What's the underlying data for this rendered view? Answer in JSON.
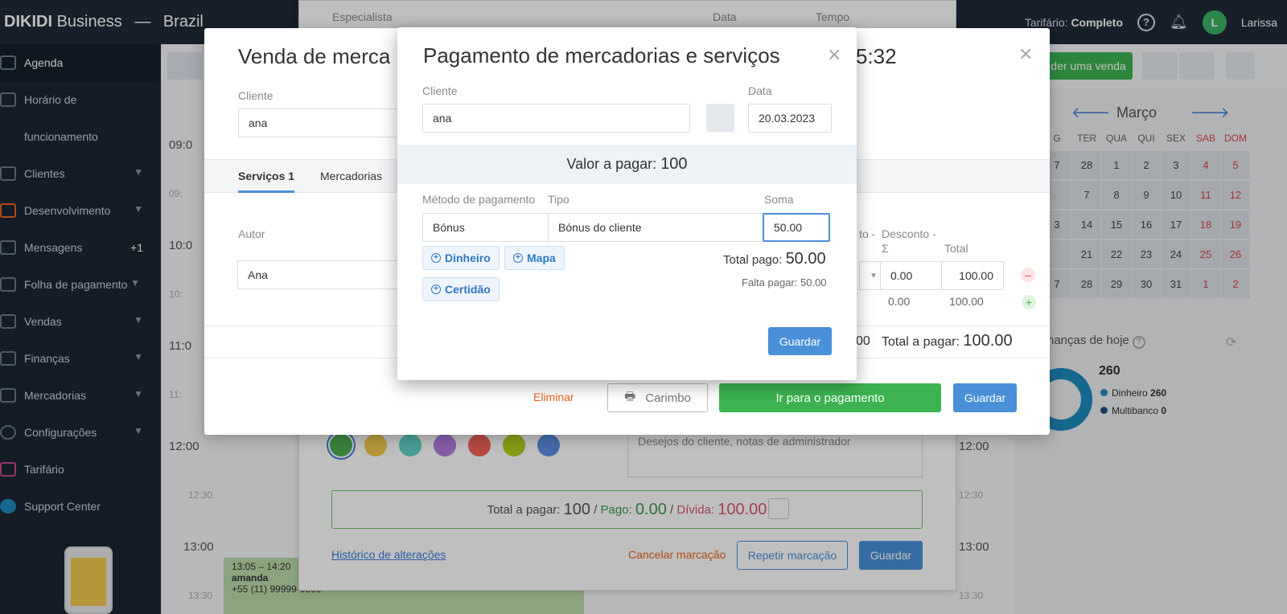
{
  "topbar": {
    "brand_bold": "DIKIDI",
    "brand_rest": "Business",
    "brand_sep": "—",
    "region": "Brazil",
    "tariff_label": "Tarifário:",
    "tariff_value": "Completo",
    "user_initial": "L",
    "user_name": "Larissa"
  },
  "sidebar": {
    "items": [
      {
        "label": "Agenda"
      },
      {
        "label": "Horário de"
      },
      {
        "label": "funcionamento"
      },
      {
        "label": "Clientes"
      },
      {
        "label": "Desenvolvimento"
      },
      {
        "label": "Mensagens",
        "badge": "+1"
      },
      {
        "label": "Folha de pagamento"
      },
      {
        "label": "Vendas"
      },
      {
        "label": "Finanças"
      },
      {
        "label": "Mercadorias"
      },
      {
        "label": "Configurações"
      },
      {
        "label": "Tarifário"
      },
      {
        "label": "Support Center"
      }
    ]
  },
  "schedule": {
    "times": [
      "09:0",
      "09:",
      "10:0",
      "10:",
      "11:0",
      "11:",
      "12:00",
      "12:30",
      "13:00",
      "13:30"
    ],
    "right_times": [
      "12:00",
      "12:30",
      "13:00",
      "13:30"
    ],
    "event": {
      "time": "13:05 – 14:20",
      "name": "amanda",
      "phone": "+55 (11) 99999-9999"
    }
  },
  "right_panel": {
    "sell_button": "der uma venda",
    "month": "Março",
    "weekdays": [
      "G",
      "TER",
      "QUA",
      "QUI",
      "SEX",
      "SAB",
      "DOM"
    ],
    "weeks": [
      [
        "7",
        "28",
        "1",
        "2",
        "3",
        "4",
        "5"
      ],
      [
        "",
        "7",
        "8",
        "9",
        "10",
        "11",
        "12"
      ],
      [
        "3",
        "14",
        "15",
        "16",
        "17",
        "18",
        "19"
      ],
      [
        "",
        "21",
        "22",
        "23",
        "24",
        "25",
        "26"
      ],
      [
        "7",
        "28",
        "29",
        "30",
        "31",
        "1",
        "2"
      ]
    ],
    "finance_title": "nanças de hoje",
    "finance_total": "260",
    "finance_rows": [
      {
        "label": "Dinheiro",
        "value": "260",
        "color": "#1e8bbf"
      },
      {
        "label": "Multibanco",
        "value": "0",
        "color": "#1e4f82"
      }
    ]
  },
  "back_dialog": {
    "col_specialist": "Especialista",
    "col_date": "Data",
    "col_time": "Tempo",
    "notes_placeholder": "Desejos do cliente, notas de administrador",
    "total_label": "Total a pagar:",
    "total_value": "100",
    "paid_label": "Pago:",
    "paid_value": "0.00",
    "debt_label": "Dívida:",
    "debt_value": "100.00",
    "history_link": "Histórico de alterações",
    "cancel_link": "Cancelar marcação",
    "repeat_button": "Repetir marcação",
    "save_button": "Guardar",
    "colors": [
      "#4caf50",
      "#f2c94c",
      "#5fd3c9",
      "#b07be0",
      "#f2645a",
      "#b5cf1c",
      "#5b8fe3"
    ]
  },
  "sale_dialog": {
    "title": "Venda de merca",
    "time": "5:32",
    "client_label": "Cliente",
    "client_value": "ana",
    "tabs": [
      "Serviços 1",
      "Mercadorias"
    ],
    "author_label": "Autor",
    "author_value": "Ana",
    "discount_label_1": "to -",
    "discount_label_2": "Desconto -",
    "discount_label_3": "Σ",
    "total_col_label": "Total",
    "discount_value": "0.00",
    "total_value": "100.00",
    "discount_sum": "0.00",
    "total_sum": "100.00",
    "zeros": "00",
    "total_pay_label": "Total a pagar:",
    "total_pay_value": "100.00",
    "delete_link": "Eliminar",
    "stamp_button": "Carimbo",
    "go_pay_button": "Ir para o pagamento",
    "save_button": "Guardar"
  },
  "pay_dialog": {
    "title": "Pagamento de mercadorias e serviços",
    "client_label": "Cliente",
    "client_value": "ana",
    "date_label": "Data",
    "date_value": "20.03.2023",
    "amount_label": "Valor a pagar:",
    "amount_value": "100",
    "method_label": "Método de pagamento",
    "type_label": "Tipo",
    "sum_label": "Soma",
    "method_value": "Bónus",
    "type_value": "Bónus do cliente",
    "sum_value": "50.00",
    "chips": [
      "Dinheiro",
      "Mapa",
      "Certidão"
    ],
    "total_paid_label": "Total pago:",
    "total_paid_value": "50.00",
    "remaining_label": "Falta pagar:",
    "remaining_value": "50.00",
    "save_button": "Guardar"
  }
}
